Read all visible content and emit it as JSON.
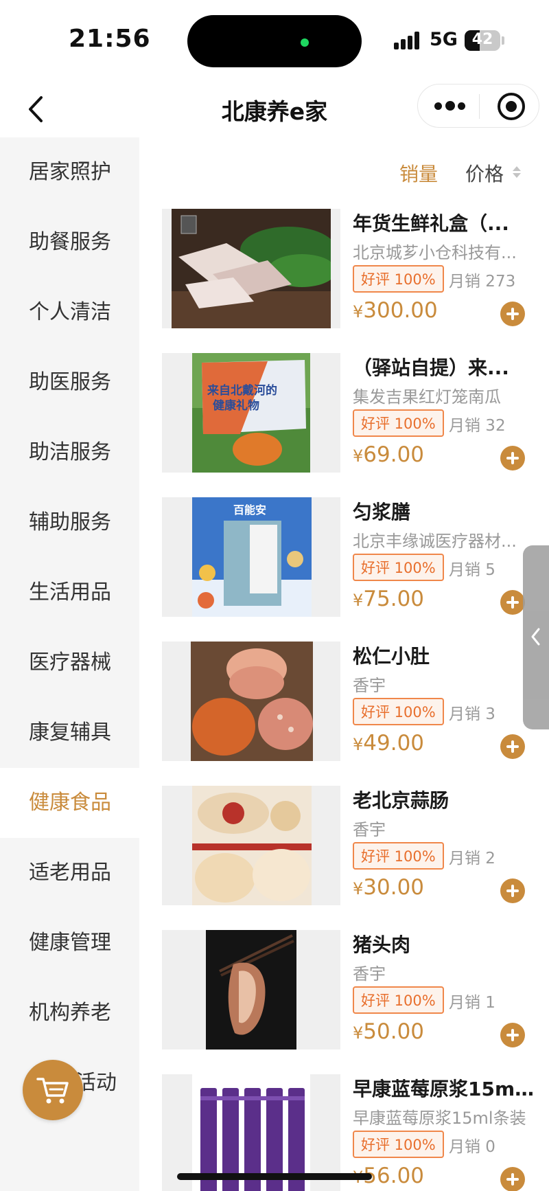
{
  "status_bar": {
    "time": "21:56",
    "network": "5G",
    "battery": "42"
  },
  "nav": {
    "title": "北康养e家",
    "back_icon": "chevron-left-icon",
    "more_icon": "more-dots-icon",
    "close_icon": "target-icon"
  },
  "sidebar": {
    "active_index": 9,
    "items": [
      {
        "label": "居家照护"
      },
      {
        "label": "助餐服务"
      },
      {
        "label": "个人清洁"
      },
      {
        "label": "助医服务"
      },
      {
        "label": "助洁服务"
      },
      {
        "label": "辅助服务"
      },
      {
        "label": "生活用品"
      },
      {
        "label": "医疗器械"
      },
      {
        "label": "康复辅具"
      },
      {
        "label": "健康食品"
      },
      {
        "label": "适老用品"
      },
      {
        "label": "健康管理"
      },
      {
        "label": "机构养老"
      },
      {
        "label": "活动"
      }
    ]
  },
  "sort": {
    "sales_label": "销量",
    "price_label": "价格"
  },
  "colors": {
    "accent": "#c98b3c",
    "badge": "#e86f2d",
    "sidebar_bg": "#f5f5f5"
  },
  "products": [
    {
      "title": "年货生鲜礼盒（...",
      "shop": "北京城芗小仓科技有...",
      "rating": "好评 100%",
      "sales": "月销 273",
      "currency": "¥",
      "price": "300.00"
    },
    {
      "title": "（驿站自提）来...",
      "shop": "集发吉果红灯笼南瓜",
      "rating": "好评 100%",
      "sales": "月销 32",
      "currency": "¥",
      "price": "69.00"
    },
    {
      "title": "匀浆膳",
      "shop": "北京丰缘诚医疗器材...",
      "rating": "好评 100%",
      "sales": "月销 5",
      "currency": "¥",
      "price": "75.00"
    },
    {
      "title": "松仁小肚",
      "shop": "香宇",
      "rating": "好评 100%",
      "sales": "月销 3",
      "currency": "¥",
      "price": "49.00"
    },
    {
      "title": "老北京蒜肠",
      "shop": "香宇",
      "rating": "好评 100%",
      "sales": "月销 2",
      "currency": "¥",
      "price": "30.00"
    },
    {
      "title": "猪头肉",
      "shop": "香宇",
      "rating": "好评 100%",
      "sales": "月销 1",
      "currency": "¥",
      "price": "50.00"
    },
    {
      "title": "早康蓝莓原浆15m...",
      "shop": "早康蓝莓原浆15ml条装",
      "rating": "好评 100%",
      "sales": "月销 0",
      "currency": "¥",
      "price": "56.00"
    }
  ],
  "image_text": {
    "product2_box_line1": "来自北戴河的",
    "product2_box_line2": "健康礼物",
    "product3_brand": "百能安"
  },
  "floating": {
    "cart_icon": "cart-icon",
    "handle_icon": "chevron-left-icon"
  }
}
